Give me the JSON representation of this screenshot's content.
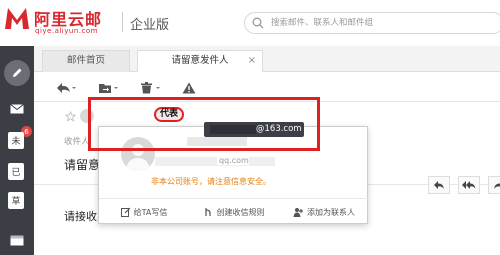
{
  "brand": {
    "name": "阿里云邮",
    "url": "qiye.aliyun.com",
    "edition": "企业版",
    "accent_color": "#d9272e"
  },
  "search": {
    "placeholder": "搜索邮件、联系人和邮件组"
  },
  "sidebar": {
    "compose_icon": "pencil-icon",
    "inbox_icon": "envelope-icon",
    "items": [
      {
        "label": "未",
        "badge": "6"
      },
      {
        "label": "已"
      },
      {
        "label": "草"
      }
    ],
    "calendar_icon": "calendar-icon"
  },
  "tabs": [
    {
      "label": "邮件首页"
    },
    {
      "label": "请留意发件人",
      "close": "×"
    }
  ],
  "toolbar": {
    "icons": [
      "reply-icon",
      "move-folder-icon",
      "delete-icon",
      "spam-warning-icon"
    ]
  },
  "mail": {
    "recipient_label": "收件人",
    "subject": "请留意",
    "body": "请接收",
    "proxy_badge": "代表",
    "sender_email_suffix": "@163.com"
  },
  "popup": {
    "email_suffix": "qq.com",
    "warning": "非本公司账号，请注意信息安全。",
    "actions": [
      {
        "label": "给TA写信",
        "icon": "compose-icon"
      },
      {
        "label": "创建收信规则",
        "icon": "rule-icon"
      },
      {
        "label": "添加为联系人",
        "icon": "add-contact-icon"
      }
    ]
  },
  "colors": {
    "rail": "#3b3e44",
    "annotation": "#e02020",
    "warning": "#e27e0c"
  }
}
